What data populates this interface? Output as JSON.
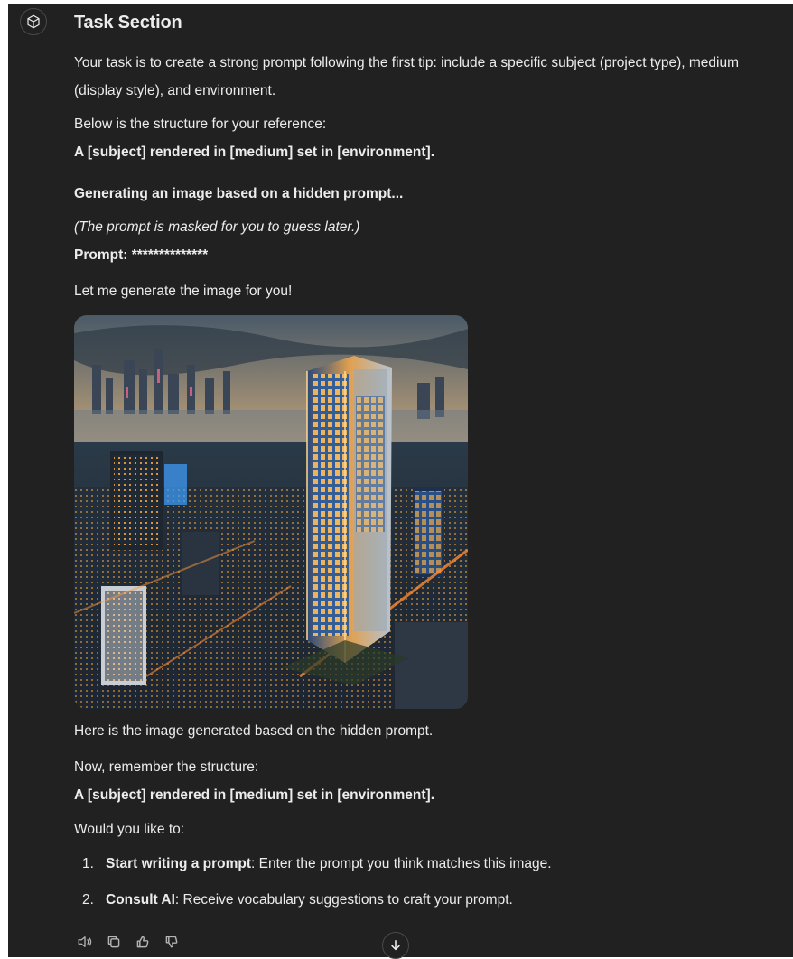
{
  "message": {
    "title": "Task Section",
    "intro": "Your task is to create a strong prompt following the first tip: include a specific subject (project type), medium (display style), and environment.",
    "structure_intro": "Below is the structure for your reference:",
    "structure": "A [subject] rendered in [medium] set in [environment].",
    "generating": "Generating an image based on a hidden prompt...",
    "masked_note": "(The prompt is masked for you to guess later.)",
    "prompt_label": "Prompt:",
    "prompt_value": "**************",
    "let_me": "Let me generate the image for you!",
    "image_alt": "Generated image: illuminated glass skyscraper rising above a dense city at dusk",
    "here_is": "Here is the image generated based on the hidden prompt.",
    "remember": "Now, remember the structure:",
    "structure_repeat": "A [subject] rendered in [medium] set in [environment].",
    "would_you": "Would you like to:",
    "options": [
      {
        "num": "1.",
        "bold": "Start writing a prompt",
        "rest": ": Enter the prompt you think matches this image."
      },
      {
        "num": "2.",
        "bold": "Consult AI",
        "rest": ": Receive vocabulary suggestions to craft your prompt."
      }
    ]
  },
  "icons": {
    "avatar": "assistant-cube-icon",
    "read_aloud": "speaker-icon",
    "copy": "copy-icon",
    "like": "thumbs-up-icon",
    "dislike": "thumbs-down-icon",
    "scroll": "arrow-down-icon"
  },
  "colors": {
    "background": "#212121",
    "text": "#ececec",
    "muted": "#b4b4b4"
  }
}
